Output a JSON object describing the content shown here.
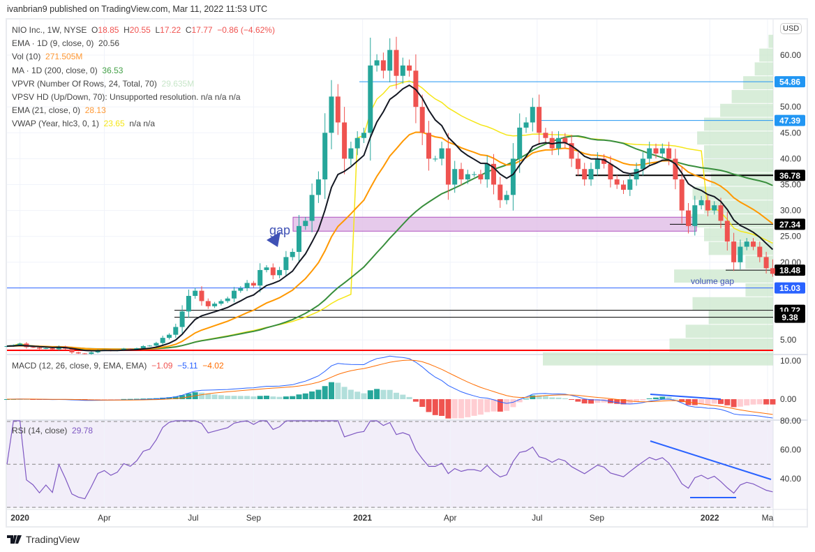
{
  "publisher": "ivanbrian9 published on TradingView.com, Mar 11, 2022 11:53 UTC",
  "currency": "USD",
  "legend": {
    "symbol": "NIO Inc., 1W, NYSE",
    "o_label": "O",
    "o": "18.85",
    "h_label": "H",
    "h": "20.55",
    "l_label": "L",
    "l": "17.22",
    "c_label": "C",
    "c": "17.77",
    "change": "−0.86 (−4.62%)",
    "ema9": "EMA · 1D (9, close, 0)",
    "ema9_val": "20.56",
    "vol": "Vol (10)",
    "vol_val": "271.505M",
    "ma200": "MA · 1D (200, close, 0)",
    "ma200_val": "36.53",
    "vpvr": "VPVR (Number Of Rows, 24, Total, 70)",
    "vpvr_val": "29.635M",
    "vpsv": "VPSV HD (Up/Down, 70): Unsupported resolution.  n/a  n/a  n/a",
    "ema21": "EMA (21, close, 0)",
    "ema21_val": "28.13",
    "vwap": "VWAP (Year, hlc3, 0, 1)",
    "vwap_val": "23.65",
    "vwap_na": "n/a  n/a"
  },
  "macd_legend": {
    "label": "MACD (12, 26, close, 9, EMA, EMA)",
    "hist": "−1.09",
    "macd": "−5.11",
    "signal": "−4.02"
  },
  "rsi_legend": {
    "label": "RSI (14, close)",
    "value": "29.78"
  },
  "annotations": {
    "gap": "gap",
    "volume_gap": "volume gap"
  },
  "footer": "TradingView",
  "colors": {
    "up": "#26a69a",
    "down": "#ef5350",
    "ema9": "#131722",
    "ema21": "#ff9800",
    "ma200": "#388e3c",
    "vwap": "#f5e616",
    "macd": "#2962ff",
    "signal": "#ff6d00",
    "rsi": "#7e57c2"
  },
  "chart_data": {
    "type": "candlestick",
    "title": "NIO Inc., 1W, NYSE",
    "ylim": [
      0,
      64
    ],
    "price_ticks": [
      "60.00",
      "50.00",
      "45.00",
      "40.00",
      "35.00",
      "30.00",
      "25.00",
      "20.00",
      "5.00"
    ],
    "time_ticks": [
      {
        "label": "2020",
        "week": 2
      },
      {
        "label": "Apr",
        "week": 15
      },
      {
        "label": "Jul",
        "week": 28.7
      },
      {
        "label": "Sep",
        "week": 38
      },
      {
        "label": "2021",
        "week": 54.8
      },
      {
        "label": "Apr",
        "week": 68.3
      },
      {
        "label": "Jul",
        "week": 81.7
      },
      {
        "label": "Sep",
        "week": 90.9
      },
      {
        "label": "2022",
        "week": 108.3
      },
      {
        "label": "Ma",
        "week": 117.2
      }
    ],
    "weekly_close": [
      3.8,
      4.0,
      4.3,
      3.6,
      3.5,
      3.3,
      3.4,
      3.2,
      3.7,
      3.3,
      2.6,
      2.4,
      2.3,
      2.6,
      3.0,
      3.1,
      2.9,
      3.0,
      3.3,
      3.2,
      3.4,
      3.8,
      3.9,
      4.4,
      5.4,
      6.0,
      7.5,
      10.5,
      13.5,
      14.5,
      12.5,
      11.5,
      12.0,
      12.5,
      13.0,
      14.5,
      15.0,
      16.0,
      15.5,
      18.5,
      19.0,
      17.5,
      18.5,
      21.0,
      22.0,
      27.0,
      28.0,
      33.0,
      36.0,
      45.0,
      52.0,
      47.0,
      40.0,
      42.0,
      44.0,
      45.0,
      58.0,
      59.0,
      57.0,
      61.0,
      56.0,
      58.0,
      57.0,
      50.0,
      45.0,
      40.0,
      40.0,
      42.0,
      35.0,
      38.0,
      36.0,
      37.0,
      37.0,
      36.0,
      39.0,
      35.0,
      32.0,
      33.0,
      40.0,
      46.0,
      47.0,
      50.0,
      45.0,
      44.0,
      42.0,
      44.0,
      43.0,
      40.0,
      38.0,
      36.0,
      38.0,
      40.0,
      39.0,
      36.0,
      35.0,
      34.0,
      36.0,
      38.0,
      40.0,
      42.0,
      41.0,
      42.0,
      40.0,
      36.0,
      30.0,
      27.0,
      31.0,
      32.0,
      30.0,
      31.0,
      28.0,
      24.0,
      20.0,
      23.0,
      24.0,
      23.0,
      21.0,
      18.85,
      17.77
    ],
    "last_bar": {
      "open": 18.85,
      "high": 20.55,
      "low": 17.22,
      "close": 17.77
    },
    "price_levels": [
      {
        "label": "54.86",
        "value": 54.86,
        "color": "#2196f3"
      },
      {
        "label": "47.39",
        "value": 47.39,
        "color": "#2196f3"
      },
      {
        "label": "36.78",
        "value": 36.78,
        "color": "#000000"
      },
      {
        "label": "27.34",
        "value": 27.34,
        "color": "#000000"
      },
      {
        "label": "18.48",
        "value": 18.48,
        "color": "#000000"
      },
      {
        "label": "15.03",
        "value": 15.03,
        "color": "#2962ff"
      },
      {
        "label": "10.72",
        "value": 10.72,
        "color": "#000000"
      },
      {
        "label": "9.38",
        "value": 9.38,
        "color": "#000000"
      }
    ],
    "support_line": 3.0,
    "gap_zone": [
      26.0,
      28.7
    ],
    "volume_profile_rel": [
      1.0,
      0.45,
      0.38,
      0.28,
      0.35,
      0.12,
      0.43,
      0.12,
      0.28,
      0.3,
      0.38,
      0.3,
      0.35,
      0.27,
      0.3,
      0.3,
      0.33,
      0.3,
      0.23,
      0.18,
      0.13,
      0.08,
      0.06,
      0.02
    ],
    "macd_ticks": [
      "10.00",
      "0.00"
    ],
    "rsi_ticks": [
      "80.00",
      "60.00",
      "40.00"
    ]
  }
}
